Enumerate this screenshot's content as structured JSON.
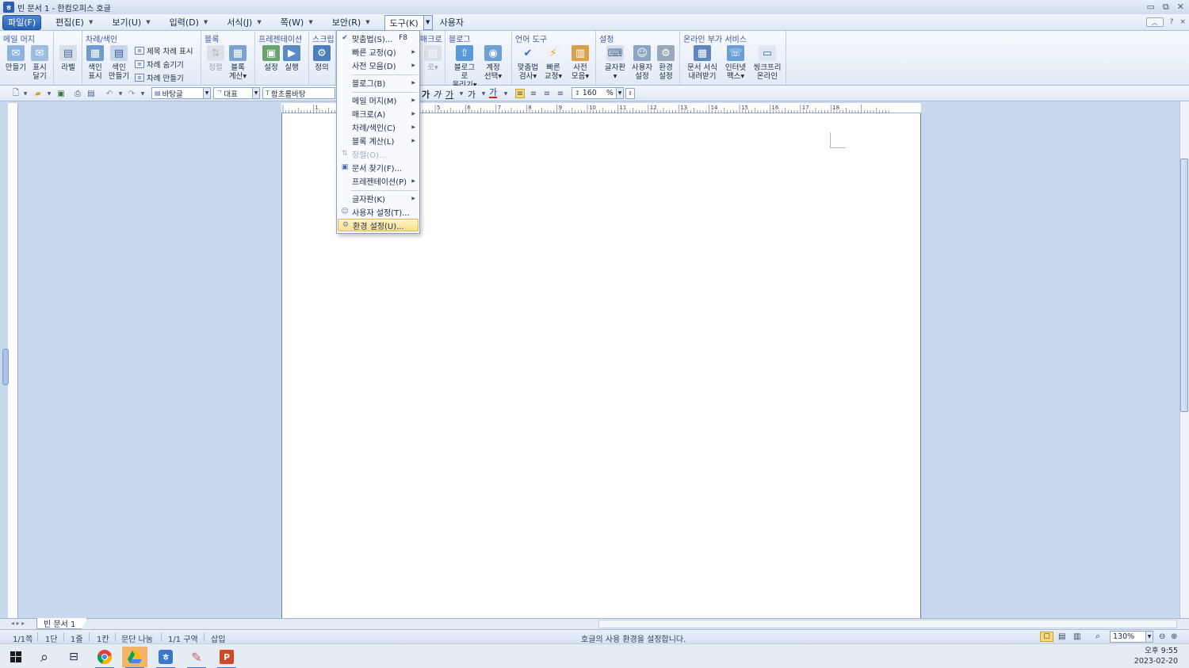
{
  "window": {
    "app_icon": "hwp-icon",
    "title": "빈 문서 1 - 한컴오피스 호글",
    "controls": [
      "minimize-icon",
      "restore-icon",
      "close-icon"
    ]
  },
  "menubar": {
    "items": [
      "파일(F)",
      "편집(E)",
      "보기(U)",
      "입력(D)",
      "서식(J)",
      "쪽(W)",
      "보안(R)",
      "도구(K)",
      "사용자"
    ],
    "help": "?",
    "close": "×"
  },
  "ribbon": {
    "groups": [
      {
        "title": "메일 머지",
        "buttons": [
          "만들기",
          "표시\n달기"
        ]
      },
      {
        "title": "",
        "buttons": [
          "라벨"
        ]
      },
      {
        "title": "차례/색인",
        "buttons": [
          "색인\n표시",
          "색인\n만들기"
        ],
        "small": [
          "제목 차례 표시",
          "차례 숨기기",
          "차례 만들기"
        ]
      },
      {
        "title": "블록",
        "buttons": [
          "정렬",
          "블록\n계산▾"
        ]
      },
      {
        "title": "프레젠테이션",
        "buttons": [
          "설정",
          "실행"
        ]
      },
      {
        "title": "스크립",
        "buttons": [
          "정의"
        ]
      },
      {
        "title": "매크로",
        "buttons": [
          "로▾"
        ]
      },
      {
        "title": "블로그",
        "buttons": [
          "블로그로\n올리기▾",
          "계정\n선택▾"
        ]
      },
      {
        "title": "언어 도구",
        "buttons": [
          "맞춤법\n검사▾",
          "빠른\n교정▾",
          "사전\n모음▾"
        ]
      },
      {
        "title": "설정",
        "buttons": [
          "글자판\n▾",
          "사용자\n설정",
          "환경\n설정"
        ]
      },
      {
        "title": "온라인 부가 서비스",
        "buttons": [
          "문서 서식\n내려받기",
          "인터넷\n팩스▾",
          "씽크프리\n온라인"
        ]
      }
    ]
  },
  "format_toolbar": {
    "style": "바탕글",
    "lang": "대표",
    "font": "함초롬바탕",
    "char_buttons": [
      "가",
      "가",
      "가",
      "가",
      "가"
    ],
    "line_spacing": "160",
    "line_spacing_unit": "%"
  },
  "tools_menu": {
    "items": [
      {
        "label": "맞춤법(S)...",
        "shortcut": "F8",
        "icon": "spellcheck-icon"
      },
      {
        "label": "빠른 교정(Q)",
        "submenu": true
      },
      {
        "label": "사전 모음(D)",
        "submenu": true
      },
      {
        "label": "블로그(B)",
        "submenu": true
      },
      {
        "label": "메일 머지(M)",
        "submenu": true
      },
      {
        "label": "매크로(A)",
        "submenu": true
      },
      {
        "label": "차례/색인(C)",
        "submenu": true
      },
      {
        "label": "블록 계산(L)",
        "submenu": true
      },
      {
        "label": "정렬(O)...",
        "disabled": true,
        "icon": "sort-icon"
      },
      {
        "label": "문서 찾기(F)...",
        "icon": "find-doc-icon"
      },
      {
        "label": "프레젠테이션(P)",
        "submenu": true
      },
      {
        "label": "글자판(K)",
        "submenu": true
      },
      {
        "label": "사용자 설정(T)...",
        "icon": "user-settings-icon"
      },
      {
        "label": "환경 설정(U)...",
        "icon": "gear-icon",
        "highlighted": true
      }
    ]
  },
  "ruler_numbers": [
    "1",
    "2",
    "3",
    "4",
    "5",
    "6",
    "7",
    "8",
    "9",
    "10",
    "11",
    "12",
    "13",
    "14",
    "15",
    "16",
    "17",
    "18"
  ],
  "doc_tab": "빈 문서 1",
  "status": {
    "page": "1/1쪽",
    "col": "1단",
    "line": "1줄",
    "char": "1칸",
    "section_break": "문단 나눔",
    "section": "1/1 구역",
    "mode": "삽입",
    "message": "호글의 사용 환경을 설정합니다.",
    "zoom": "130%"
  },
  "taskbar": {
    "apps": [
      "windows-start-icon",
      "search-icon",
      "task-view-icon",
      "chrome-icon",
      "google-drive-icon",
      "hwp-icon",
      "paint-icon",
      "powerpoint-icon"
    ],
    "time": "오후 9:55",
    "date": "2023-02-20"
  }
}
